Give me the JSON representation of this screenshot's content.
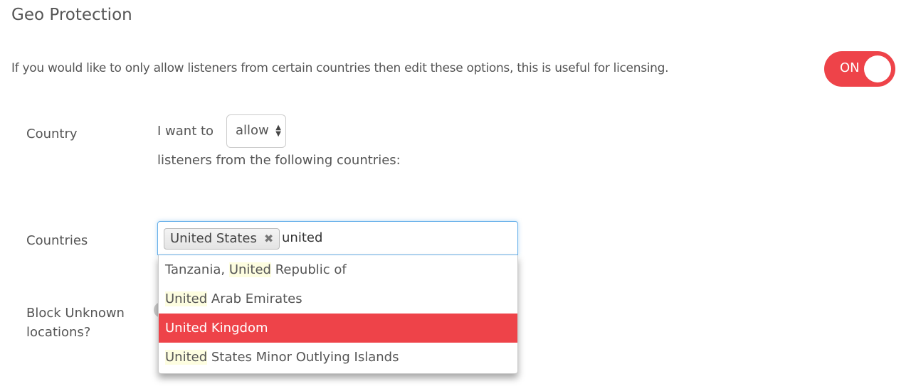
{
  "title": "Geo Protection",
  "description": "If you would like to only allow listeners from certain countries then edit these options, this is useful for licensing.",
  "geo_toggle": {
    "label": "ON",
    "state": true,
    "color": "#ee4349"
  },
  "country": {
    "label": "Country",
    "prefix": "I want to",
    "mode": "allow",
    "suffix": "listeners from the following countries:"
  },
  "countries": {
    "label": "Countries",
    "selected_tags": [
      "United States"
    ],
    "typed": "united",
    "options": [
      {
        "pre": "Tanzania, ",
        "match": "United",
        "post": " Republic of",
        "active": false
      },
      {
        "pre": "",
        "match": "United",
        "post": " Arab Emirates",
        "active": false
      },
      {
        "pre": "",
        "match": "United",
        "post": " Kingdom",
        "active": true
      },
      {
        "pre": "",
        "match": "United",
        "post": " States Minor Outlying Islands",
        "active": false
      }
    ]
  },
  "block_unknown": {
    "label_line1": "Block Unknown",
    "label_line2": "locations?"
  }
}
